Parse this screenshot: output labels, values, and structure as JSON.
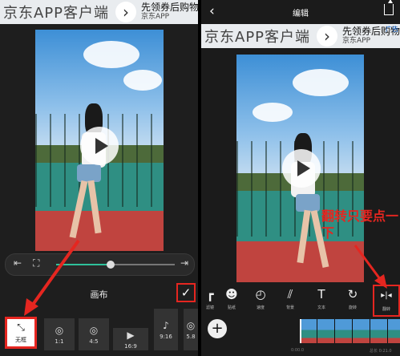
{
  "ad": {
    "title": "京东APP客户端",
    "arrow": "›",
    "promo": "先领券后购物",
    "app": "京东APP",
    "badge": "广告"
  },
  "left": {
    "scrubber": {
      "rewind_icon": "⇤",
      "fullscreen_icon": "⛶",
      "forward_icon": "⇥",
      "progress": 0.46
    },
    "canvas_title": "画布",
    "confirm_icon": "✓",
    "ratios": [
      {
        "label": "无框",
        "icon": "⤡"
      },
      {
        "label": "1:1",
        "icon": "◎"
      },
      {
        "label": "4:5",
        "icon": "◎"
      },
      {
        "label": "16:9",
        "icon": "▶"
      },
      {
        "label": "9:16",
        "icon": "♪"
      },
      {
        "label": "5.8",
        "icon": "◎"
      }
    ]
  },
  "right": {
    "topbar": {
      "back": "‹",
      "title": "编辑"
    },
    "annotation": "翻转只要点一下",
    "tools": [
      {
        "label": "滤镜",
        "icon": "┏"
      },
      {
        "label": "贴纸",
        "icon": "☻"
      },
      {
        "label": "速度",
        "icon": "◴"
      },
      {
        "label": "背景",
        "icon": "⫽"
      },
      {
        "label": "文本",
        "icon": "T"
      },
      {
        "label": "旋转",
        "icon": "↻"
      },
      {
        "label": "翻转",
        "icon": "▸|◂"
      }
    ],
    "add": "+",
    "time_left": "0:00.0",
    "time_right": "总长 0:21.0"
  }
}
